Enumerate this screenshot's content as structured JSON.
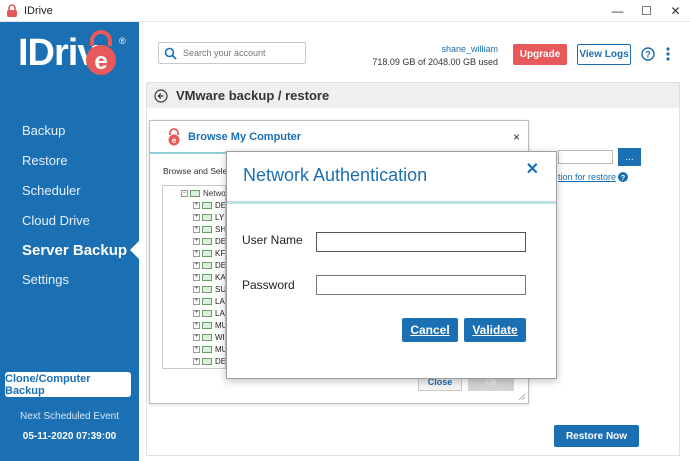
{
  "window": {
    "title": "IDrive",
    "minimize": "—",
    "maximize": "☐",
    "close": "✕"
  },
  "brand": {
    "logo_text": "IDriv",
    "logo_e": "e",
    "registered": "®",
    "color": "#1b6fb3"
  },
  "sidebar": {
    "items": [
      {
        "label": "Backup",
        "active": false
      },
      {
        "label": "Restore",
        "active": false
      },
      {
        "label": "Scheduler",
        "active": false
      },
      {
        "label": "Cloud Drive",
        "active": false
      },
      {
        "label": "Server Backup",
        "active": true
      },
      {
        "label": "Settings",
        "active": false
      }
    ],
    "clone_button": "Clone/Computer Backup",
    "next_scheduled_label": "Next Scheduled Event",
    "next_scheduled_date": "05-11-2020 07:39:00"
  },
  "header": {
    "search_placeholder": "Search your account",
    "username": "shane_william",
    "usage": "718.09 GB of 2048.00 GB used",
    "upgrade": "Upgrade",
    "view_logs": "View Logs",
    "accent_red": "#e8595b"
  },
  "content": {
    "title": "VMware backup / restore",
    "browse_button": "...",
    "restore_location_link": "tion for restore",
    "restore_now": "Restore Now"
  },
  "browse_dialog": {
    "title": "Browse My Computer",
    "close": "×",
    "subtitle": "Browse and Sele",
    "root_label": "Netwo",
    "items": [
      "DE",
      "LY",
      "SH",
      "DE",
      "KF",
      "DE",
      "KA",
      "SU",
      "LA",
      "LA",
      "MU",
      "WI",
      "MU",
      "DE"
    ],
    "close_button": "Close",
    "ok_button": "Ok"
  },
  "auth_dialog": {
    "title": "Network Authentication",
    "close": "✕",
    "username_label": "User Name",
    "username_value": "",
    "password_label": "Password",
    "password_value": "",
    "cancel": "Cancel",
    "validate": "Validate"
  }
}
